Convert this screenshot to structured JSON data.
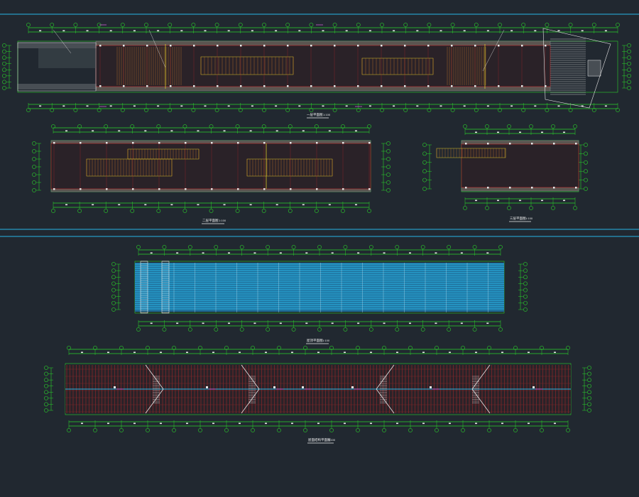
{
  "drawing": {
    "background": "#212830",
    "colors": {
      "grid_green": "#2bd22b",
      "frame_red": "#c02a2a",
      "white": "#e8e8e8",
      "cyan": "#28b6e6",
      "yellow": "#d8c42a",
      "orange": "#c8782a",
      "magenta": "#c85ad2",
      "grey": "#7f8a8a",
      "title_white": "#f0f0f0"
    }
  },
  "views": [
    {
      "id": "plan-1",
      "title": "一层平面图",
      "scale": "1:100"
    },
    {
      "id": "plan-2",
      "title": "二层平面图",
      "scale": "1:100"
    },
    {
      "id": "plan-3",
      "title": "三层平面图",
      "scale": "1:100"
    },
    {
      "id": "roof-plan",
      "title": "屋顶平面图",
      "scale": "1:100"
    },
    {
      "id": "structure-plan",
      "title": "屋面结构平面图",
      "scale": "1:100"
    }
  ]
}
